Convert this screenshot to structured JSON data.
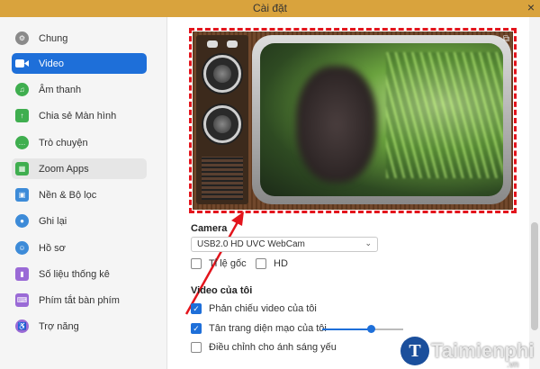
{
  "window": {
    "title": "Cài đặt",
    "close_symbol": "×"
  },
  "sidebar": {
    "items": [
      {
        "label": "Chung",
        "icon": "gear-icon",
        "color": "#8a8a8a"
      },
      {
        "label": "Video",
        "icon": "video-icon",
        "color": "#ffffff"
      },
      {
        "label": "Âm thanh",
        "icon": "headphone-icon",
        "color": "#3fae4f"
      },
      {
        "label": "Chia sẻ Màn hình",
        "icon": "share-screen-icon",
        "color": "#3fae4f"
      },
      {
        "label": "Trò chuyện",
        "icon": "chat-icon",
        "color": "#3fae4f"
      },
      {
        "label": "Zoom Apps",
        "icon": "apps-icon",
        "color": "#3fae4f"
      },
      {
        "label": "Nền & Bộ lọc",
        "icon": "background-icon",
        "color": "#3d8bd8"
      },
      {
        "label": "Ghi lại",
        "icon": "record-icon",
        "color": "#3d8bd8"
      },
      {
        "label": "Hồ sơ",
        "icon": "profile-icon",
        "color": "#3d8bd8"
      },
      {
        "label": "Số liệu thống kê",
        "icon": "stats-icon",
        "color": "#9a6ad6"
      },
      {
        "label": "Phím tắt bàn phím",
        "icon": "keyboard-icon",
        "color": "#9a6ad6"
      },
      {
        "label": "Trợ năng",
        "icon": "accessibility-icon",
        "color": "#9a6ad6"
      }
    ],
    "active_index": 1
  },
  "camera": {
    "label": "Camera",
    "selected": "USB2.0 HD UVC WebCam",
    "options": [
      {
        "label": "Tỉ lệ gốc",
        "checked": false
      },
      {
        "label": "HD",
        "checked": false
      }
    ]
  },
  "my_video": {
    "label": "Video của tôi",
    "options": [
      {
        "label": "Phản chiếu video của tôi",
        "checked": true
      },
      {
        "label": "Tân trang diện mạo của tôi",
        "checked": true
      },
      {
        "label": "Điều chỉnh cho ánh sáng yếu",
        "checked": false
      }
    ],
    "touch_up_level": 0.6
  },
  "watermark": {
    "name": "Taimienphi",
    "logo_letter": "T",
    "suffix": ".vn"
  },
  "colors": {
    "accent": "#1e6fd9",
    "annotation_red": "#e3141c",
    "titlebar": "#d9a33d"
  }
}
